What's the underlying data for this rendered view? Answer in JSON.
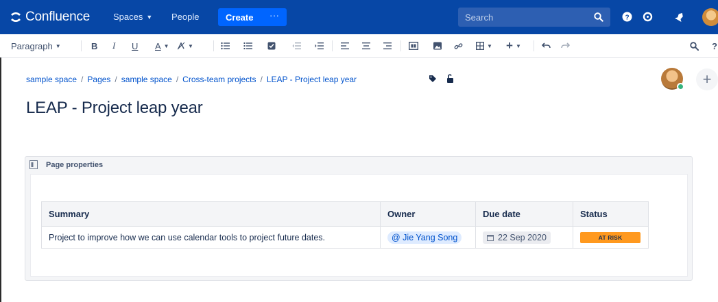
{
  "topnav": {
    "brand": "Confluence",
    "spaces_label": "Spaces",
    "people_label": "People",
    "create_label": "Create",
    "more_label": "···",
    "search_placeholder": "Search",
    "icons": [
      "confluence-logo-icon",
      "search-icon",
      "help-icon",
      "settings-icon",
      "notifications-icon",
      "avatar"
    ],
    "bg_color": "#0747a6",
    "create_color": "#0065ff"
  },
  "toolbar": {
    "paragraph_label": "Paragraph",
    "bold": "B",
    "italic": "I",
    "underline": "U",
    "text_color": "A"
  },
  "breadcrumb": [
    "sample space",
    "Pages",
    "sample space",
    "Cross-team projects",
    "LEAP - Project leap year"
  ],
  "page": {
    "title": "LEAP - Project leap year"
  },
  "macro": {
    "title": "Page properties",
    "table": {
      "headers": [
        "Summary",
        "Owner",
        "Due date",
        "Status"
      ],
      "row": {
        "summary": "Project to improve how we can use calendar tools to project future dates.",
        "owner": "@ Jie Yang Song",
        "due_date": "22 Sep 2020",
        "status": "AT RISK"
      }
    },
    "status_color": "#ff991f",
    "mention_color": "#deebff"
  }
}
